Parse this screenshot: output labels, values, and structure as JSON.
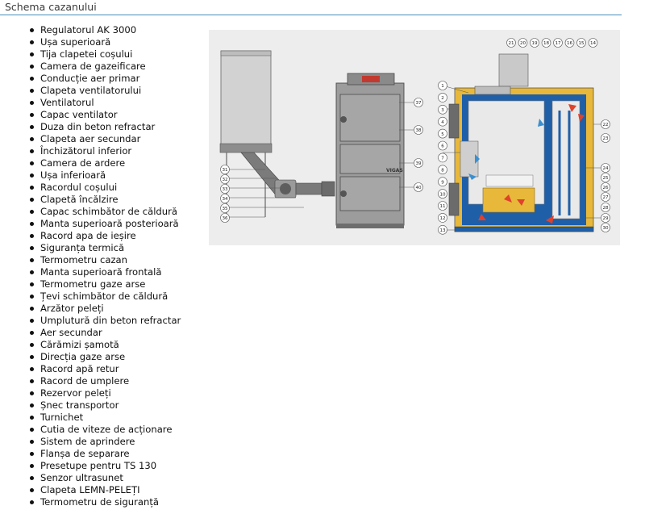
{
  "header": {
    "title": "Schema cazanului"
  },
  "parts": [
    "Regulatorul AK 3000",
    "Ușa superioară",
    "Tija clapetei coșului",
    "Camera de gazeificare",
    "Conducție aer primar",
    "Clapeta ventilatorului",
    "Ventilatorul",
    "Capac ventilator",
    "Duza din beton refractar",
    "Clapeta aer secundar",
    "Închizătorul inferior",
    "Camera de ardere",
    "Ușa inferioară",
    "Racordul coșului",
    "Clapetă încălzire",
    "Capac schimbător de căldură",
    "Manta superioară posterioară",
    "Racord apa de ieșire",
    "Siguranța termică",
    "Termometru cazan",
    "Manta superioară frontală",
    "Termometru gaze arse",
    "Țevi schimbător de căldură",
    "Arzător peleți",
    "Umplutură din beton refractar",
    "Aer secundar",
    "Cărămizi șamotă",
    "Direcția gaze arse",
    "Racord apă retur",
    "Racord de umplere",
    "Rezervor peleți",
    "Șnec transportor",
    "Turnichet",
    "Cutia de viteze de acționare",
    "Sistem de aprindere",
    "Flanșa de separare",
    "Presetupe pentru  TS 130",
    "Senzor ultrasunet",
    "Clapeta LEMN-PELEȚI",
    "Termometru de siguranță"
  ],
  "diagram": {
    "brand_label": "VIGAS",
    "colors": {
      "panel": "#ededed",
      "insulation": "#e8b83a",
      "water_jacket": "#1f5fa8",
      "flame": "#e0412b",
      "air": "#3a8fd0",
      "body": "#8a8a8a"
    },
    "left_callouts_a": [
      "31",
      "32",
      "33",
      "34",
      "35",
      "36"
    ],
    "right_callouts_a": [
      "37",
      "38",
      "39",
      "40"
    ],
    "top_callouts_b": [
      "21",
      "20",
      "19",
      "18",
      "17",
      "16",
      "15",
      "14"
    ],
    "left_callouts_b": [
      "1",
      "2",
      "3",
      "4",
      "5",
      "6",
      "7",
      "8",
      "9",
      "10",
      "11",
      "12",
      "13"
    ],
    "right_callouts_b": [
      "22",
      "23",
      "24",
      "25",
      "26",
      "27",
      "28",
      "29",
      "30"
    ]
  }
}
